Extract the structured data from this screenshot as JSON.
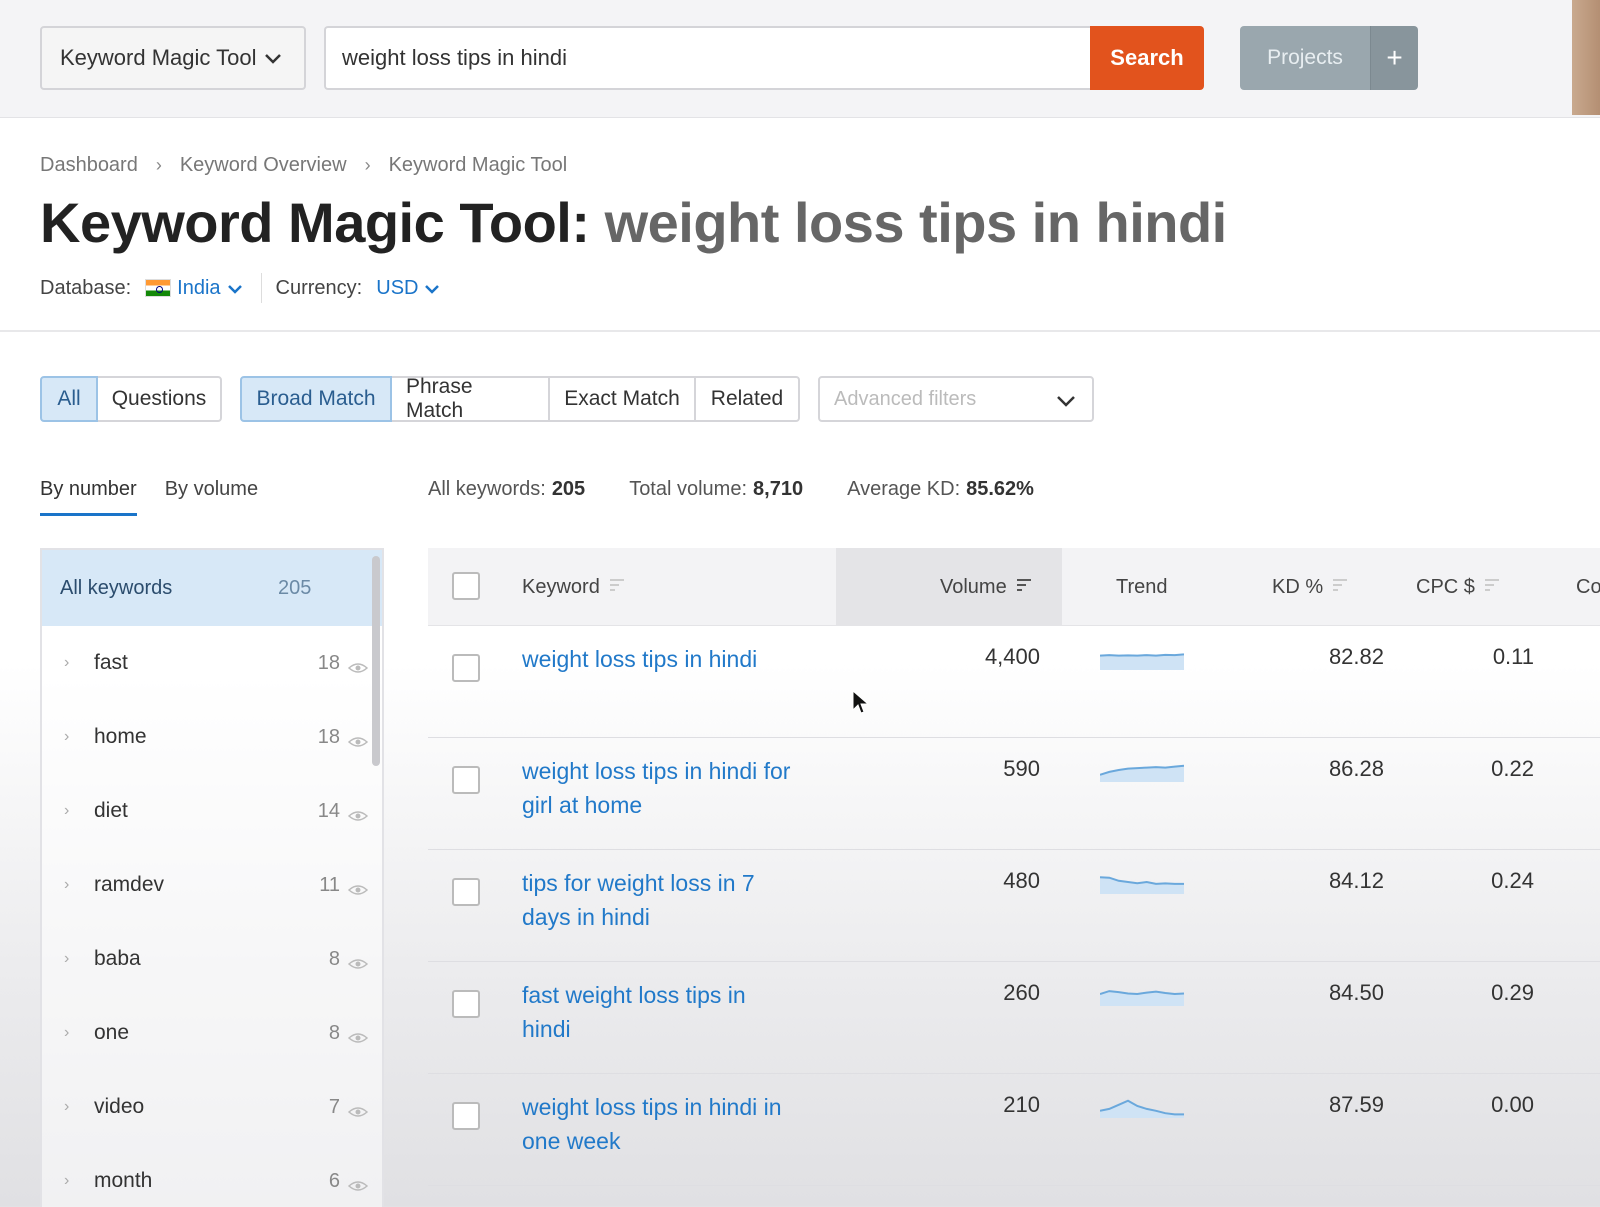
{
  "topbar": {
    "tool_select": "Keyword Magic Tool",
    "search_value": "weight loss tips in hindi",
    "search_button": "Search",
    "projects_button": "Projects",
    "add_project": "+"
  },
  "breadcrumb": [
    "Dashboard",
    "Keyword Overview",
    "Keyword Magic Tool"
  ],
  "title": {
    "tool": "Keyword Magic Tool:",
    "query": "weight loss tips in hindi"
  },
  "database": {
    "label": "Database:",
    "value": "India",
    "currency_label": "Currency:",
    "currency_value": "USD"
  },
  "filters": {
    "scope": [
      "All",
      "Questions"
    ],
    "match": [
      "Broad Match",
      "Phrase Match",
      "Exact Match",
      "Related"
    ],
    "advanced": "Advanced filters"
  },
  "sidebar": {
    "tabs": [
      "By number",
      "By volume"
    ],
    "all_label": "All keywords",
    "all_count": "205",
    "groups": [
      {
        "label": "fast",
        "count": "18"
      },
      {
        "label": "home",
        "count": "18"
      },
      {
        "label": "diet",
        "count": "14"
      },
      {
        "label": "ramdev",
        "count": "11"
      },
      {
        "label": "baba",
        "count": "8"
      },
      {
        "label": "one",
        "count": "8"
      },
      {
        "label": "video",
        "count": "7"
      },
      {
        "label": "month",
        "count": "6"
      }
    ]
  },
  "summary": {
    "all_keywords_label": "All keywords:",
    "all_keywords": "205",
    "total_volume_label": "Total volume:",
    "total_volume": "8,710",
    "avg_kd_label": "Average KD:",
    "avg_kd": "85.62%"
  },
  "table": {
    "columns": [
      "Keyword",
      "Volume",
      "Trend",
      "KD %",
      "CPC $",
      "Co"
    ],
    "rows": [
      {
        "keyword": "weight loss tips in hindi",
        "volume": "4,400",
        "kd": "82.82",
        "cpc": "0.11",
        "trend": [
          0.6,
          0.62,
          0.6,
          0.61,
          0.6,
          0.62,
          0.6,
          0.63,
          0.62,
          0.65
        ]
      },
      {
        "keyword": "weight loss tips in hindi for girl at home",
        "volume": "590",
        "kd": "86.28",
        "cpc": "0.22",
        "trend": [
          0.3,
          0.42,
          0.5,
          0.56,
          0.58,
          0.6,
          0.62,
          0.6,
          0.64,
          0.68
        ]
      },
      {
        "keyword": "tips for weight loss in 7 days in hindi",
        "volume": "480",
        "kd": "84.12",
        "cpc": "0.24",
        "trend": [
          0.7,
          0.68,
          0.55,
          0.5,
          0.45,
          0.5,
          0.42,
          0.44,
          0.42,
          0.42
        ]
      },
      {
        "keyword": "fast weight loss tips in hindi",
        "volume": "260",
        "kd": "84.50",
        "cpc": "0.29",
        "trend": [
          0.5,
          0.62,
          0.58,
          0.52,
          0.5,
          0.56,
          0.6,
          0.54,
          0.5,
          0.52
        ]
      },
      {
        "keyword": "weight loss tips in hindi in one week",
        "volume": "210",
        "kd": "87.59",
        "cpc": "0.00",
        "trend": [
          0.3,
          0.38,
          0.55,
          0.72,
          0.5,
          0.38,
          0.3,
          0.2,
          0.15,
          0.15
        ]
      }
    ]
  },
  "colors": {
    "accent_orange": "#e2531d",
    "link_blue": "#2179c9",
    "active_bg": "#d7e8f7"
  }
}
